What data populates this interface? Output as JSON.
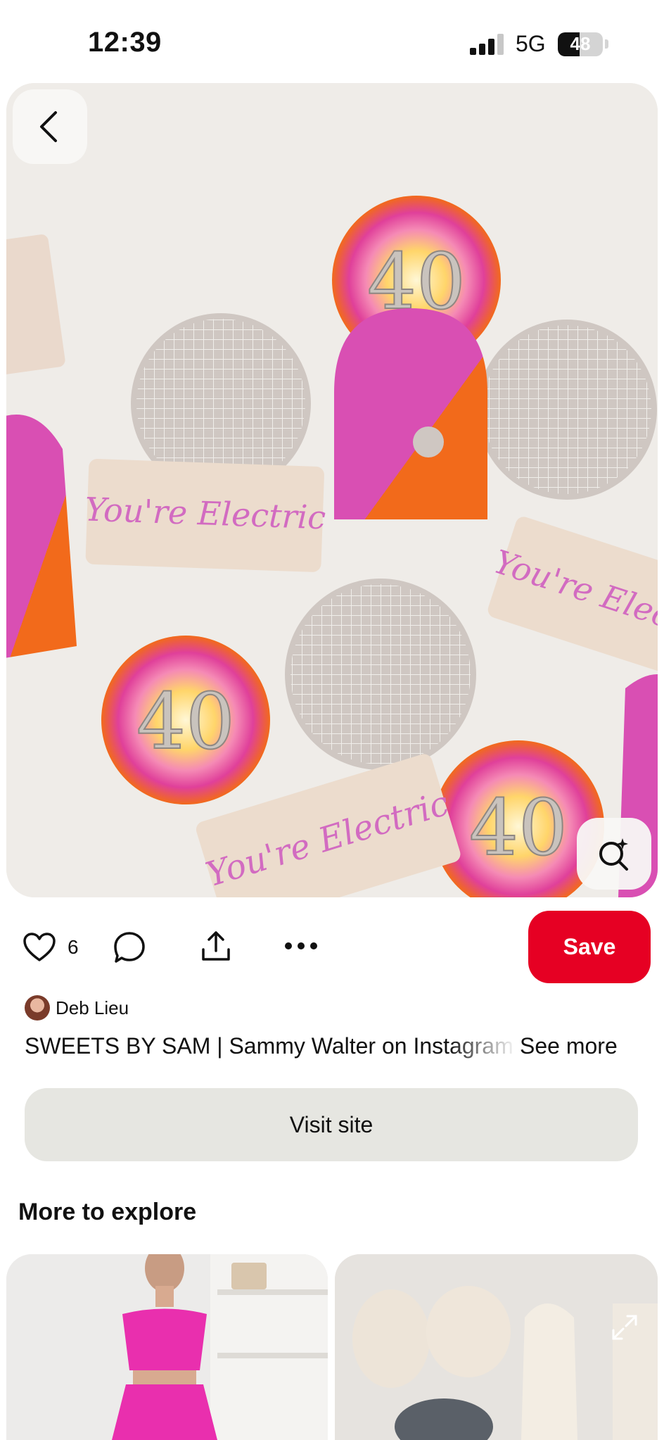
{
  "status_bar": {
    "time": "12:39",
    "network": "5G",
    "battery_level": "48",
    "battery_fraction": 0.48
  },
  "pin": {
    "image_subject": "decorated cookies",
    "cookie_text_1": "You're Electric",
    "cookie_text_2": "You're Electric",
    "cookie_text_3": "You're Electric",
    "cookie_number": "40",
    "like_count": "6",
    "save_label": "Save",
    "author_name": "Deb Lieu",
    "description": "SWEETS BY SAM | Sammy Walter on Instagram",
    "see_more_label": "See more",
    "visit_label": "Visit site"
  },
  "explore": {
    "title": "More to explore"
  },
  "icons": {
    "back": "chevron-left-icon",
    "lens": "visual-search-icon",
    "like": "heart-icon",
    "comment": "comment-icon",
    "share": "share-icon",
    "more": "more-icon",
    "expand": "expand-icon"
  },
  "colors": {
    "save_red": "#e60023",
    "visit_bg": "#e6e6e1",
    "pink": "#d94fb3",
    "orange": "#f26a1b"
  }
}
